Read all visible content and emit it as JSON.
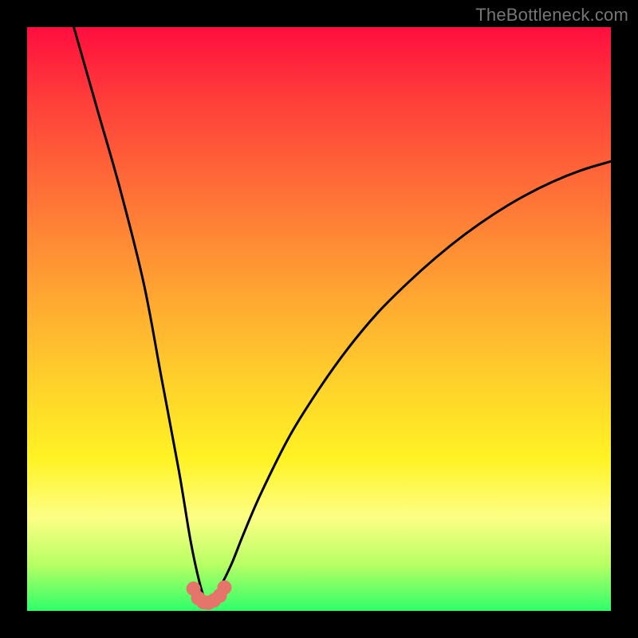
{
  "watermark": "TheBottleneck.com",
  "chart_data": {
    "type": "line",
    "title": "",
    "xlabel": "",
    "ylabel": "",
    "xlim": [
      0,
      100
    ],
    "ylim": [
      0,
      100
    ],
    "grid": false,
    "series": [
      {
        "name": "bottleneck-curve",
        "color": "#000000",
        "x": [
          8,
          12,
          16,
          20,
          23,
          26,
          28,
          29.5,
          30.5,
          31.5,
          33,
          35,
          37,
          40,
          45,
          50,
          55,
          60,
          65,
          70,
          75,
          80,
          85,
          90,
          95,
          100
        ],
        "y": [
          100,
          86,
          72,
          56,
          40,
          24,
          12,
          5,
          2,
          2,
          4,
          8,
          13,
          20,
          30,
          38,
          45,
          51,
          56,
          60.5,
          64.5,
          68,
          71,
          73.5,
          75.5,
          77
        ]
      },
      {
        "name": "curve-markers",
        "color": "#e5746a",
        "marker": true,
        "x": [
          28.5,
          29.3,
          30.2,
          31.1,
          32.0,
          33.0,
          33.8
        ],
        "y": [
          3.8,
          2.2,
          1.5,
          1.4,
          1.8,
          2.6,
          4.0
        ]
      }
    ],
    "background_gradient": [
      "#ff0e3e",
      "#ff6638",
      "#ffd42a",
      "#fdff85",
      "#2eff6a"
    ]
  }
}
